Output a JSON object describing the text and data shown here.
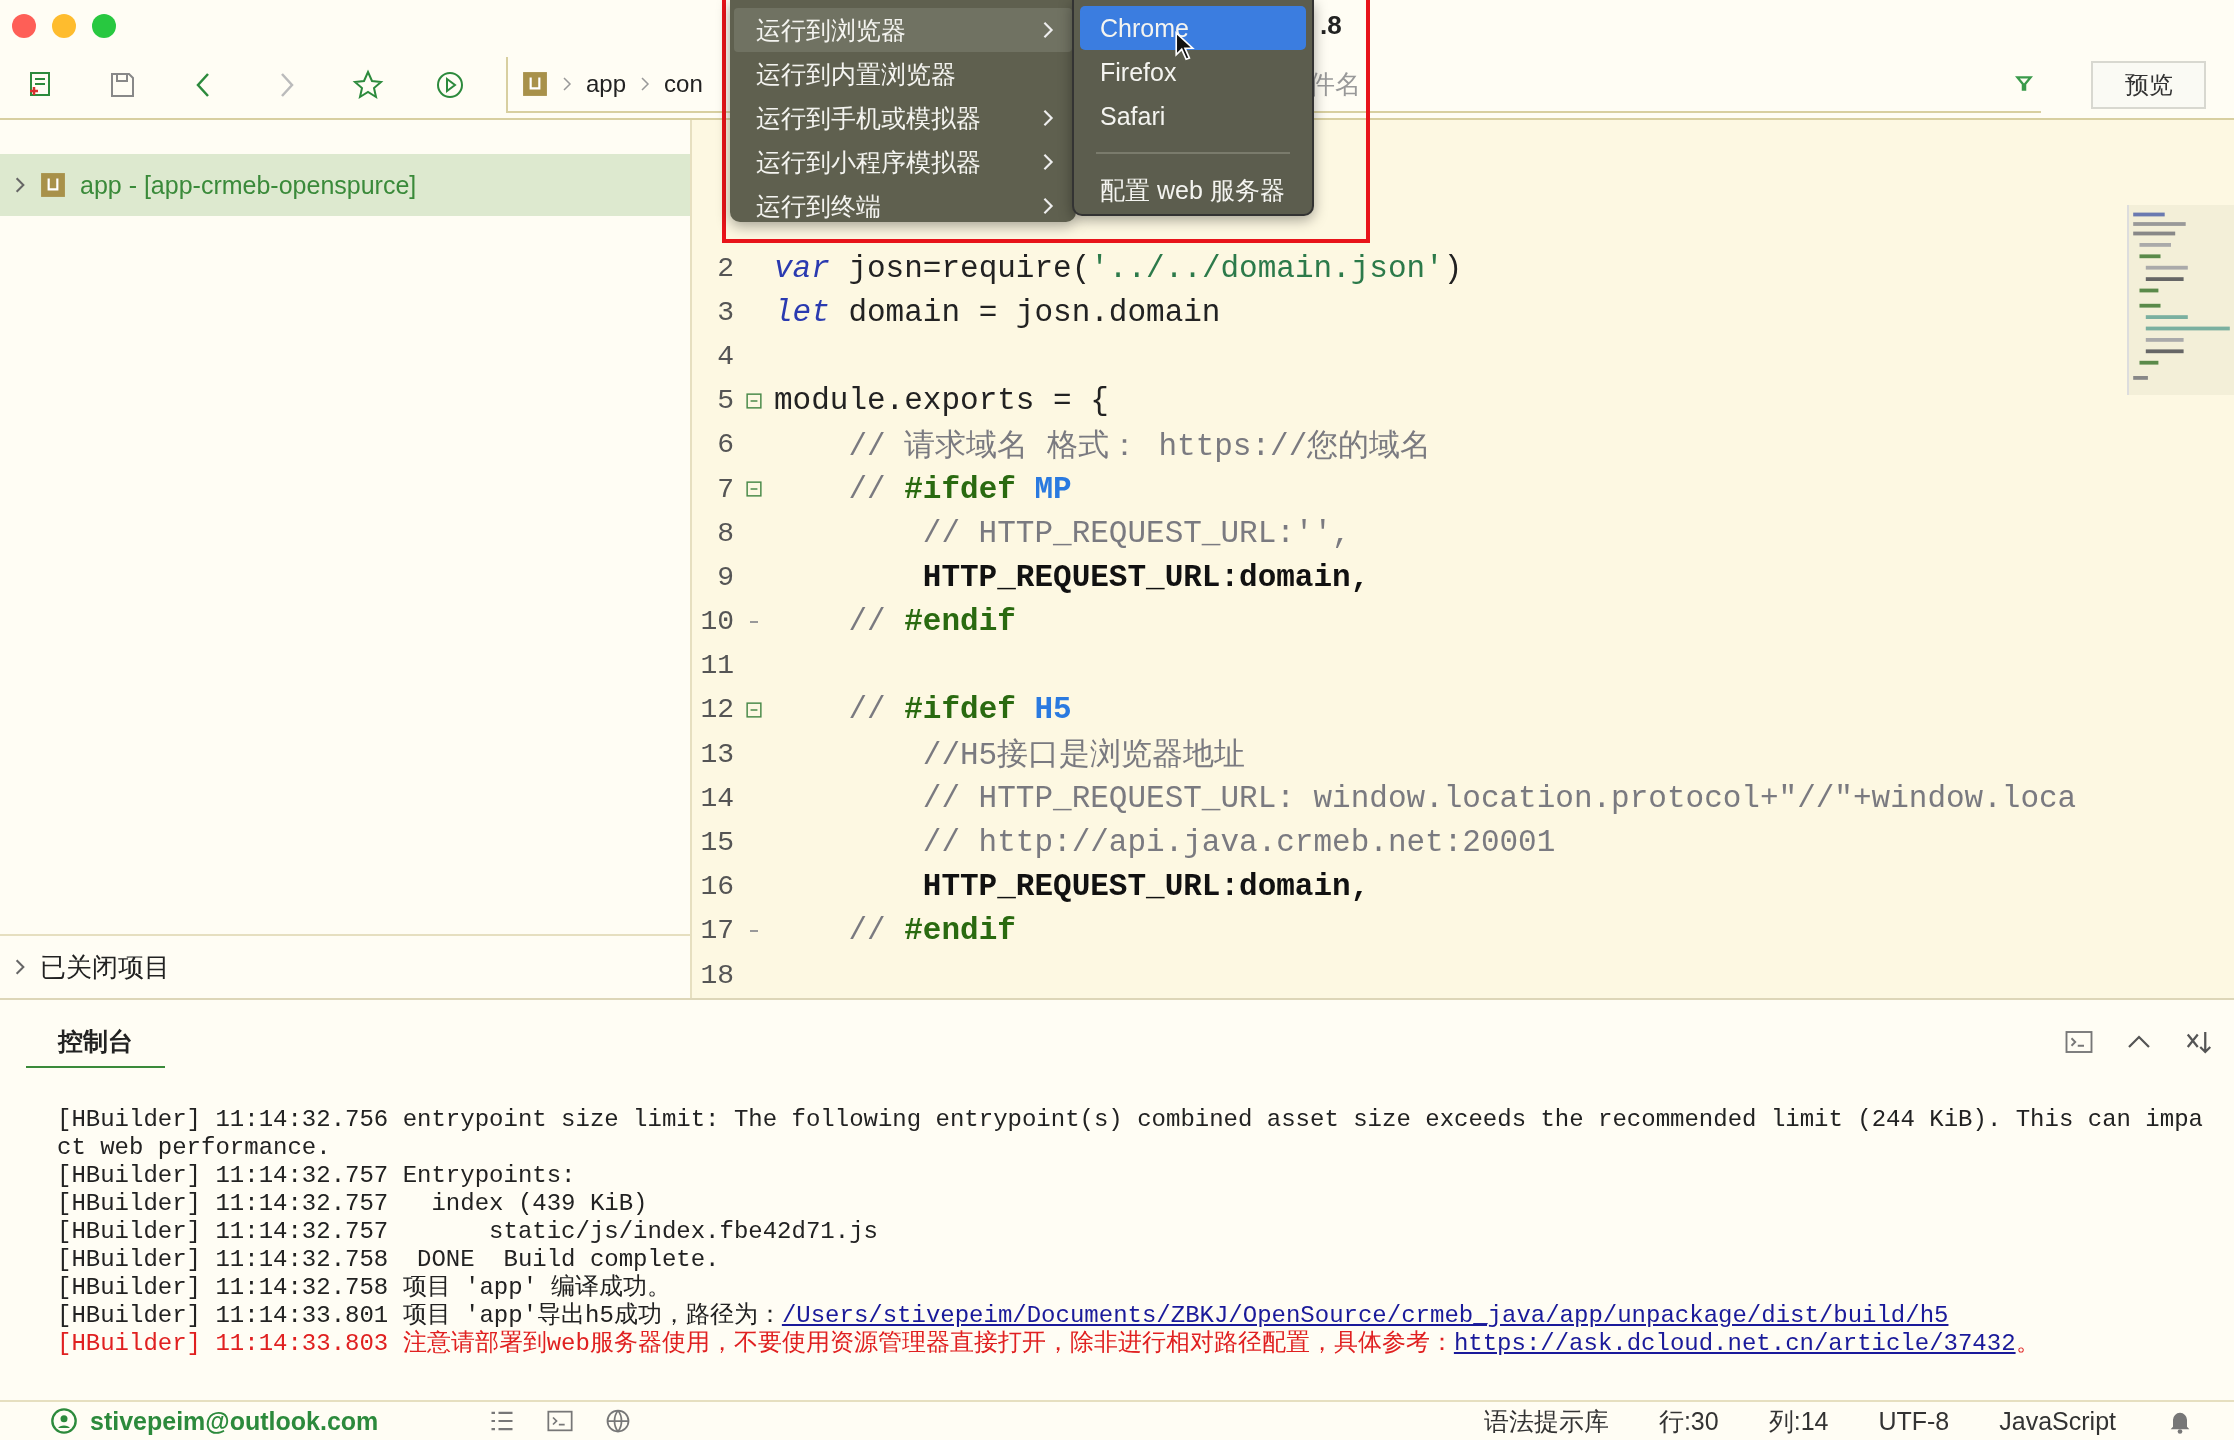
{
  "window": {
    "title_fragment": ".8"
  },
  "toolbar": {
    "breadcrumb": [
      "app",
      "con"
    ],
    "filter_placeholder": "件名",
    "preview_button": "预览"
  },
  "sidebar": {
    "projects": [
      {
        "label": "app - [app-crmeb-openspurce]",
        "selected": true,
        "expanded": false
      }
    ],
    "closed_section": {
      "label": "已关闭项目",
      "expanded": false
    }
  },
  "editor": {
    "lines": [
      {
        "number": "2",
        "tokens": [
          {
            "kind": "keyword",
            "text": "var"
          },
          {
            "kind": "plain",
            "text": " josn=require("
          },
          {
            "kind": "string",
            "text": "'../../domain.json'"
          },
          {
            "kind": "plain",
            "text": ")"
          }
        ]
      },
      {
        "number": "3",
        "tokens": [
          {
            "kind": "keyword",
            "text": "let"
          },
          {
            "kind": "plain",
            "text": " domain = josn.domain"
          }
        ]
      },
      {
        "number": "4"
      },
      {
        "number": "5",
        "foldable": true,
        "tokens": [
          {
            "kind": "plain",
            "text": "module.exports = {"
          }
        ],
        "children": [
          {
            "number": "6",
            "tokens": [
              {
                "kind": "comment",
                "text": "// 请求域名 格式： https://您的域名"
              }
            ]
          },
          {
            "number": "7",
            "foldable": true,
            "tokens": [
              {
                "kind": "comment",
                "text": "// "
              },
              {
                "kind": "directive",
                "text": "#ifdef"
              },
              {
                "kind": "macro",
                "text": " MP"
              }
            ],
            "children": [
              {
                "number": "8",
                "tokens": [
                  {
                    "kind": "comment",
                    "text": "// HTTP_REQUEST_URL:'',"
                  }
                ]
              },
              {
                "number": "9",
                "tokens": [
                  {
                    "kind": "bold",
                    "text": "HTTP_REQUEST_URL:domain,"
                  }
                ]
              }
            ]
          },
          {
            "number": "10",
            "block_end": true,
            "tokens": [
              {
                "kind": "comment",
                "text": "// "
              },
              {
                "kind": "directive",
                "text": "#endif"
              }
            ]
          },
          {
            "number": "11"
          },
          {
            "number": "12",
            "foldable": true,
            "tokens": [
              {
                "kind": "comment",
                "text": "// "
              },
              {
                "kind": "directive",
                "text": "#ifdef"
              },
              {
                "kind": "macro",
                "text": " H5"
              }
            ],
            "children": [
              {
                "number": "13",
                "tokens": [
                  {
                    "kind": "comment",
                    "text": "//H5接口是浏览器地址"
                  }
                ]
              },
              {
                "number": "14",
                "tokens": [
                  {
                    "kind": "comment",
                    "text": "// HTTP_REQUEST_URL: window.location.protocol+\"//\"+window.loca"
                  }
                ]
              },
              {
                "number": "15",
                "tokens": [
                  {
                    "kind": "comment",
                    "text": "// http://api.java.crmeb.net:20001"
                  }
                ]
              },
              {
                "number": "16",
                "tokens": [
                  {
                    "kind": "bold",
                    "text": "HTTP_REQUEST_URL:domain,"
                  }
                ]
              }
            ]
          },
          {
            "number": "17",
            "block_end": true,
            "tokens": [
              {
                "kind": "comment",
                "text": "// "
              },
              {
                "kind": "directive",
                "text": "#endif"
              }
            ]
          }
        ]
      },
      {
        "number": "18"
      }
    ]
  },
  "context_menu": {
    "items": [
      {
        "label": "运行到浏览器",
        "has_submenu": true,
        "selected": true
      },
      {
        "label": "运行到内置浏览器",
        "has_submenu": false,
        "selected": false
      },
      {
        "label": "运行到手机或模拟器",
        "has_submenu": true,
        "selected": false
      },
      {
        "label": "运行到小程序模拟器",
        "has_submenu": true,
        "selected": false
      },
      {
        "label": "运行到终端",
        "has_submenu": true,
        "selected": false
      }
    ],
    "submenu": [
      {
        "kind": "item",
        "label": "Chrome",
        "selected": true
      },
      {
        "kind": "item",
        "label": "Firefox",
        "selected": false
      },
      {
        "kind": "item",
        "label": "Safari",
        "selected": false
      },
      {
        "kind": "separator"
      },
      {
        "kind": "item",
        "label": "配置 web 服务器",
        "selected": false
      }
    ]
  },
  "console": {
    "tab": "控制台",
    "lines": [
      {
        "kind": "info",
        "source": "[HBuilder]",
        "time": "11:14:32.756",
        "message": "entrypoint size limit: The following entrypoint(s) combined asset size exceeds the recommended limit (244 KiB). This can impact web performance."
      },
      {
        "kind": "info",
        "source": "[HBuilder]",
        "time": "11:14:32.757",
        "message": "Entrypoints:"
      },
      {
        "kind": "info",
        "source": "[HBuilder]",
        "time": "11:14:32.757",
        "message": "  index (439 KiB)"
      },
      {
        "kind": "info",
        "source": "[HBuilder]",
        "time": "11:14:32.757",
        "message": "      static/js/index.fbe42d71.js"
      },
      {
        "kind": "info",
        "source": "[HBuilder]",
        "time": "11:14:32.758",
        "message": " DONE  Build complete. "
      },
      {
        "kind": "info",
        "source": "[HBuilder]",
        "time": "11:14:32.758",
        "message": "项目 'app' 编译成功。"
      },
      {
        "kind": "info",
        "source": "[HBuilder]",
        "time": "11:14:33.801",
        "message": "项目 'app'导出h5成功，路径为：",
        "link": "/Users/stivepeim/Documents/ZBKJ/OpenSource/crmeb_java/app/unpackage/dist/build/h5"
      },
      {
        "kind": "warning",
        "source": "[HBuilder]",
        "time": "11:14:33.803",
        "message": "注意请部署到web服务器使用，不要使用资源管理器直接打开，除非进行相对路径配置，具体参考：",
        "link": "https://ask.dcloud.net.cn/article/37432",
        "tail": "。"
      }
    ]
  },
  "status_bar": {
    "user": "stivepeim@outlook.com",
    "items": [
      "语法提示库",
      "行:30",
      "列:14",
      "UTF-8",
      "JavaScript"
    ]
  }
}
